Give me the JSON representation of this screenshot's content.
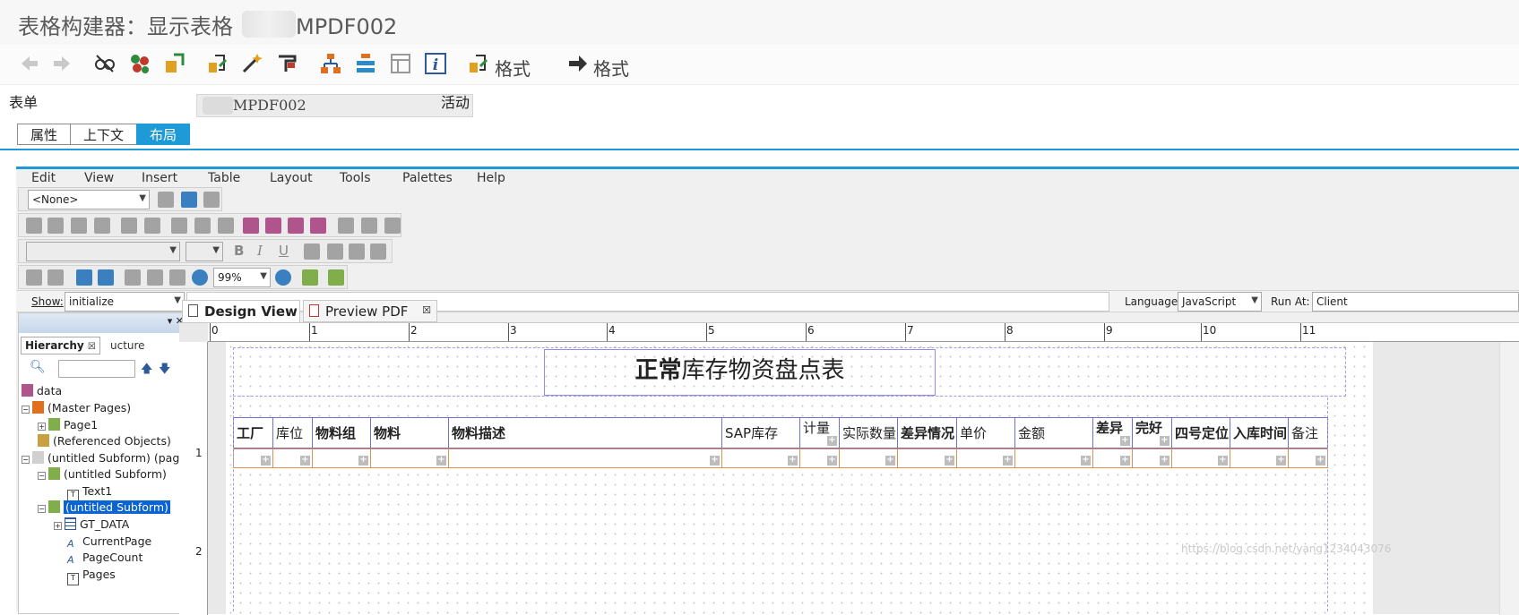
{
  "window": {
    "title": "表格构建器：显示表格",
    "title_suffix": "MPDF002"
  },
  "app_toolbar": {
    "format_label_1": "格式",
    "format_label_2": "格式"
  },
  "form": {
    "label": "表单",
    "value": "MPDF002",
    "status": "活动"
  },
  "tabs": [
    "属性",
    "上下文",
    "布局"
  ],
  "active_tab": "布局",
  "designer": {
    "menu": [
      "Edit",
      "View",
      "Insert",
      "Table",
      "Layout",
      "Tools",
      "Palettes",
      "Help"
    ],
    "style_combo": "<None>",
    "zoom": "99%",
    "script": {
      "show_label": "Show:",
      "show_value": "initialize",
      "language_label": "Language:",
      "language_value": "JavaScript",
      "run_at_label": "Run At:",
      "run_at_value": "Client"
    },
    "hierarchy": {
      "tab_label": "Hierarchy",
      "tab2_label": "ucture",
      "nodes": [
        {
          "label": "data"
        },
        {
          "label": "(Master Pages)"
        },
        {
          "label": "Page1"
        },
        {
          "label": "(Referenced Objects)"
        },
        {
          "label": "(untitled Subform) (page"
        },
        {
          "label": "(untitled Subform)"
        },
        {
          "label": "Text1"
        },
        {
          "label": "(untitled Subform)"
        },
        {
          "label": "GT_DATA"
        },
        {
          "label": "CurrentPage"
        },
        {
          "label": "PageCount"
        },
        {
          "label": "Pages"
        }
      ]
    },
    "view_tabs": {
      "design": "Design View",
      "preview": "Preview PDF"
    },
    "ruler_numbers": [
      "0",
      "1",
      "2",
      "3",
      "4",
      "5",
      "6",
      "7",
      "8",
      "9",
      "10",
      "11"
    ],
    "vruler_numbers": [
      "1",
      "2"
    ],
    "report": {
      "title_bold": "正常",
      "title_rest": "库存物资盘点表",
      "columns": [
        "工厂",
        "库位",
        "物料组",
        "物料",
        "物料描述",
        "SAP库存",
        "计量",
        "实际数量",
        "差异情况",
        "单价",
        "金额",
        "差异",
        "完好",
        "四号定位",
        "入库时间",
        "备注"
      ]
    }
  },
  "watermark": "https://blog.csdn.net/yang1234043076"
}
